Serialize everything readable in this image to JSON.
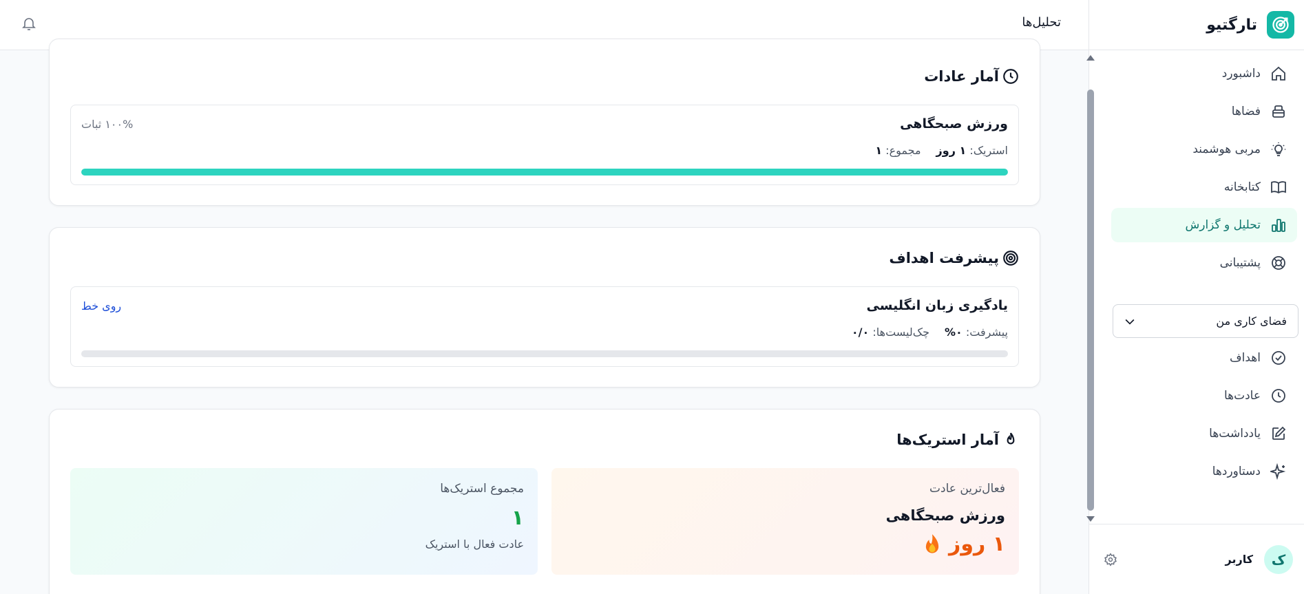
{
  "brand": {
    "name": "تارگتیو"
  },
  "header": {
    "title": "تحلیل‌ها"
  },
  "sidebar": {
    "items": [
      {
        "label": "داشبورد",
        "icon": "home-icon"
      },
      {
        "label": "فضاها",
        "icon": "box-icon"
      },
      {
        "label": "مربی هوشمند",
        "icon": "lightbulb-icon"
      },
      {
        "label": "کتابخانه",
        "icon": "book-icon"
      },
      {
        "label": "تحلیل و گزارش",
        "icon": "bar-chart-icon",
        "active": true
      },
      {
        "label": "پشتیبانی",
        "icon": "lifebuoy-icon"
      }
    ],
    "workspace": {
      "label": "فضای کاری من"
    },
    "workspace_items": [
      {
        "label": "اهداف",
        "icon": "check-circle-icon"
      },
      {
        "label": "عادت‌ها",
        "icon": "clock-icon"
      },
      {
        "label": "یادداشت‌ها",
        "icon": "edit-icon"
      },
      {
        "label": "دستاوردها",
        "icon": "sparkles-icon"
      }
    ],
    "user": {
      "avatar_letter": "ک",
      "name": "کاربر"
    }
  },
  "habits_stats": {
    "title": "آمار عادات",
    "habit": {
      "name": "ورزش صبحگاهی",
      "streak_label": "استریک:",
      "streak_value": "۱ روز",
      "total_label": "مجموع:",
      "total_value": "۱",
      "consistency": "۱۰۰% ثبات",
      "progress_fraction": 1.0
    }
  },
  "goals_progress": {
    "title": "پیشرفت اهداف",
    "goal": {
      "name": "یادگیری زبان انگلیسی",
      "progress_label": "پیشرفت:",
      "progress_value": "۰%",
      "checklist_label": "چک‌لیست‌ها:",
      "checklist_value": "۰/۰",
      "status": "روی خط",
      "progress_fraction": 0.0
    }
  },
  "streak_stats": {
    "title": "آمار استریک‌ها",
    "most_active": {
      "label": "فعال‌ترین عادت",
      "name": "ورزش صبحگاهی",
      "days": "۱ روز"
    },
    "total": {
      "label": "مجموع استریک‌ها",
      "value": "۱",
      "sub": "عادت فعال با استریک"
    }
  },
  "colors": {
    "accent": "#14b8a6",
    "progress": "#2dd4bf",
    "streak": "#ea580c",
    "total": "#16a34a",
    "link": "#1d4ed8"
  }
}
